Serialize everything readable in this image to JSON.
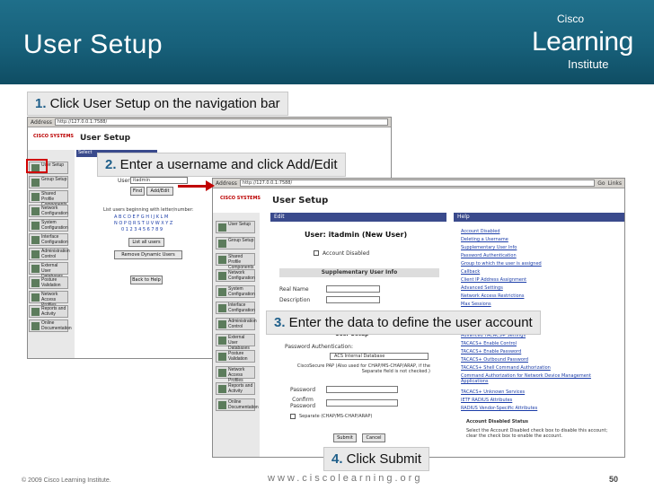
{
  "slide": {
    "title": "User Setup",
    "logo": {
      "line1": "Cisco",
      "line2": "Learning",
      "line3": "Institute"
    },
    "footer_left": "© 2009 Cisco Learning Institute.",
    "footer_center": "www.ciscolearning.org",
    "page_number": "50",
    "steps": [
      {
        "num": "1.",
        "text": " Click User Setup on the navigation bar"
      },
      {
        "num": "2.",
        "text": " Enter a username and click Add/Edit"
      },
      {
        "num": "3.",
        "text": " Enter the data to define the user account"
      },
      {
        "num": "4.",
        "text": " Click Submit"
      }
    ]
  },
  "win1": {
    "address_label": "Address",
    "address": "http://127.0.0.1:7588/",
    "logo": "CISCO SYSTEMS",
    "heading": "User Setup",
    "select_label": "Select",
    "user_label": "User:",
    "user_value": "itadmin",
    "find_button": "Find",
    "add_edit_button": "Add/Edit",
    "list_text": "List users beginning with letter/number:",
    "letters": [
      "A B C D E F G H I J K L M",
      "N O P Q R S T U V W X Y Z",
      "0 1 2 3 4 5 6 7 8 9"
    ],
    "list_all_button": "List all users",
    "remove_button": "Remove Dynamic Users",
    "back_button": "Back to Help"
  },
  "win2": {
    "address_label": "Address",
    "address": "http://127.0.0.1:7588/",
    "go_label": "Go",
    "links_label": "Links",
    "logo": "CISCO SYSTEMS",
    "heading": "User Setup",
    "edit_header": "Edit",
    "help_header": "Help",
    "user_title": "User: itadmin (New User)",
    "account_disabled": "Account Disabled",
    "supp_header": "Supplementary User Info",
    "real_name_label": "Real Name",
    "description_label": "Description",
    "user_setup_sub": "User Setup",
    "pw_auth_label": "Password Authentication:",
    "pw_select": "ACS Internal Database",
    "pap_text": "CiscoSecure PAP (Also used for CHAP/MS-CHAP/ARAP, if the Separate field is not checked.)",
    "password_label": "Password",
    "confirm_label": "Confirm Password",
    "separate_label": "Separate (CHAP/MS-CHAP/ARAP)",
    "submit_button": "Submit",
    "cancel_button": "Cancel",
    "help_links": [
      "Account Disabled",
      "Deleting a Username",
      "Supplementary User Info",
      "Password Authentication",
      "Group to which the user is assigned",
      "Callback",
      "Client IP Address Assignment",
      "Advanced Settings",
      "Network Access Restrictions",
      "Max Sessions"
    ],
    "help_links_lower": [
      "Advanced TACACS+ Settings",
      "TACACS+ Enable Control",
      "TACACS+ Enable Password",
      "TACACS+ Outbound Password",
      "TACACS+ Shell Command Authorization",
      "Command Authorization for Network Device Management Applications",
      "TACACS+ Unknown Services",
      "IETF RADIUS Attributes",
      "RADIUS Vendor-Specific Attributes"
    ],
    "acct_status_title": "Account Disabled Status",
    "acct_status_text": "Select the Account Disabled check box to disable this account; clear the check box to enable the account."
  },
  "nav1": [
    "User Setup",
    "Group Setup",
    "Shared Profile Components",
    "Network Configuration",
    "System Configuration",
    "Interface Configuration",
    "Administration Control",
    "External User Databases",
    "Posture Validation",
    "Network Access Profiles",
    "Reports and Activity",
    "Online Documentation"
  ],
  "nav2": [
    "User Setup",
    "Group Setup",
    "Shared Profile Components",
    "Network Configuration",
    "System Configuration",
    "Interface Configuration",
    "Administration Control",
    "External User Databases",
    "Posture Validation",
    "Network Access Profiles",
    "Reports and Activity",
    "Online Documentation"
  ],
  "colors": {
    "banner": "#17607a",
    "step_number": "#1f5f8a",
    "highlight": "#d00000"
  }
}
